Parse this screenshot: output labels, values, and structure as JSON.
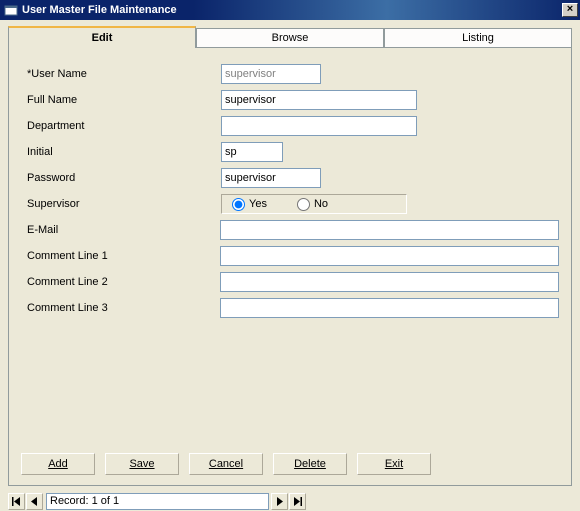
{
  "window": {
    "title": "User Master File Maintenance"
  },
  "tabs": {
    "edit": "Edit",
    "browse": "Browse",
    "listing": "Listing"
  },
  "labels": {
    "user_name": "*User Name",
    "full_name": "Full Name",
    "department": "Department",
    "initial": "Initial",
    "password": "Password",
    "supervisor": "Supervisor",
    "email": "E-Mail",
    "c1": "Comment Line 1",
    "c2": "Comment Line 2",
    "c3": "Comment Line 3"
  },
  "values": {
    "user_name": "supervisor",
    "full_name": "supervisor",
    "department": "",
    "initial": "sp",
    "password": "supervisor",
    "supervisor": "Yes",
    "email": "",
    "c1": "",
    "c2": "",
    "c3": ""
  },
  "radio": {
    "yes": "Yes",
    "no": "No"
  },
  "buttons": {
    "add": "Add",
    "save": "Save",
    "cancel": "Cancel",
    "delete": "Delete",
    "exit": "Exit"
  },
  "nav": {
    "status": "Record: 1 of 1"
  }
}
